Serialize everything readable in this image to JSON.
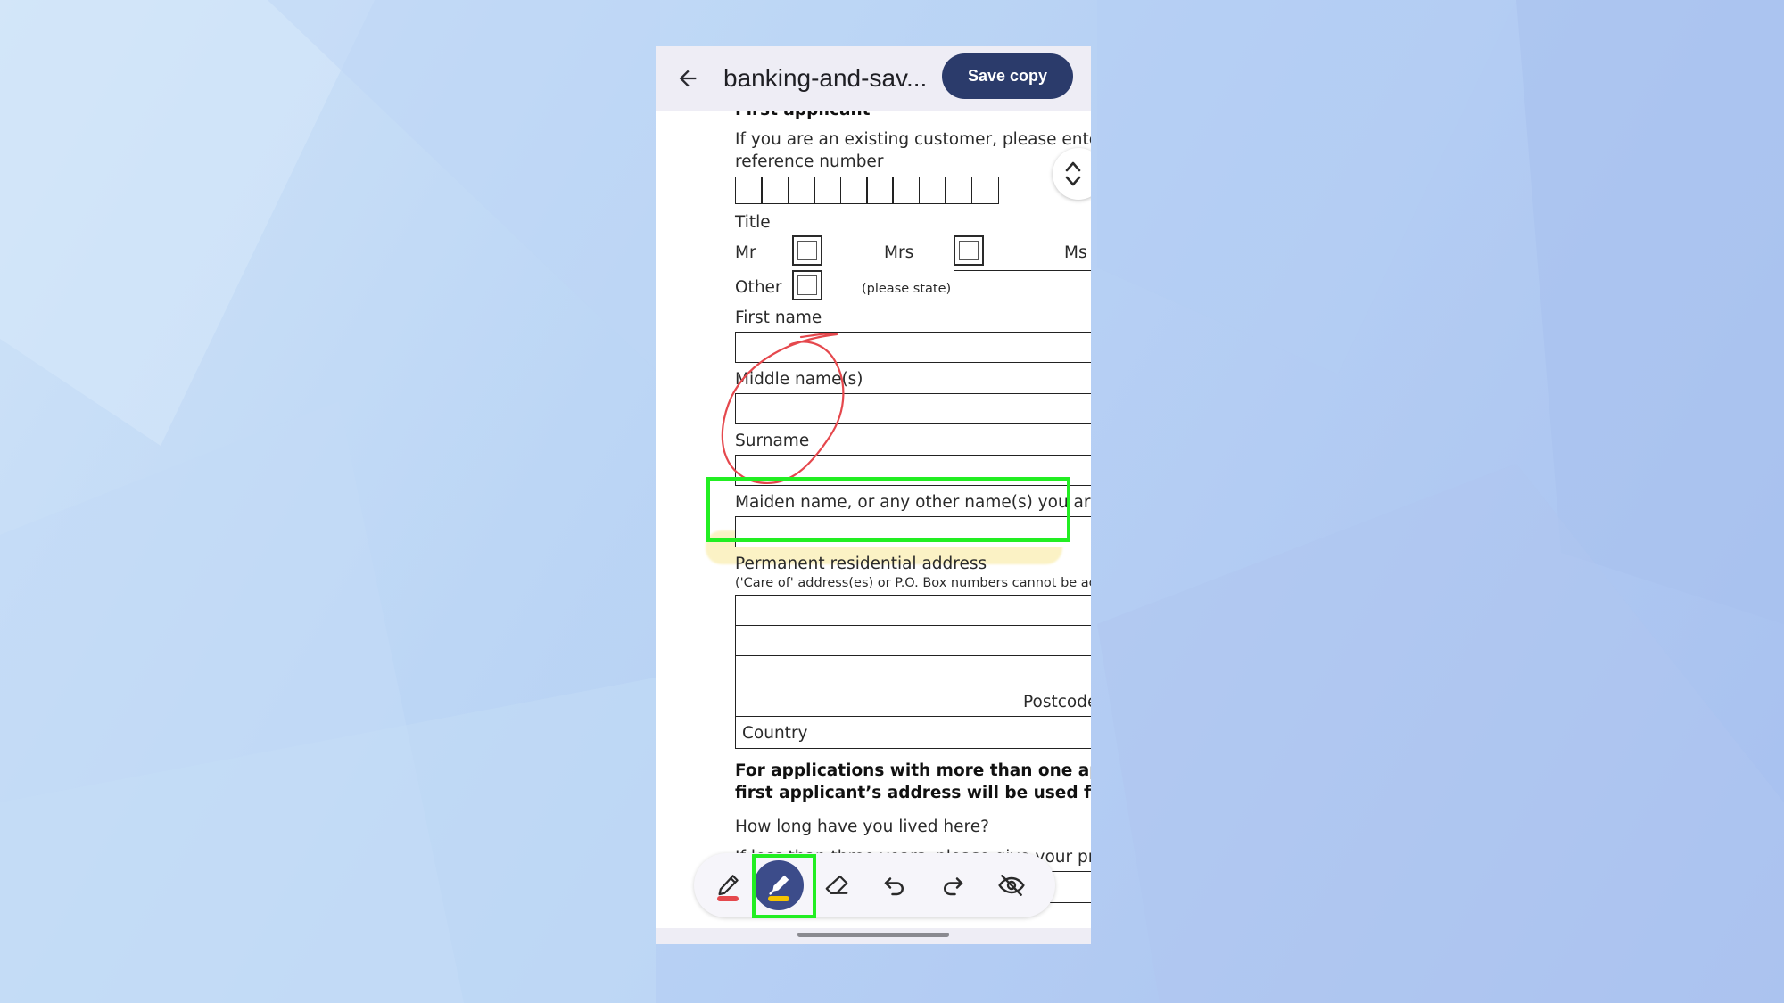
{
  "appbar": {
    "back_icon": "arrow-back-icon",
    "title": "banking-and-sav...",
    "save_label": "Save copy"
  },
  "form": {
    "section_heading": "First applicant",
    "existing_customer_text": "If you are an existing customer, please enter y",
    "reference_label": "reference number",
    "title_label": "Title",
    "mr_label": "Mr",
    "mrs_label": "Mrs",
    "ms_label": "Ms",
    "other_label": "Other",
    "please_state_label": "(please state)",
    "first_name_label": "First name",
    "middle_name_label": "Middle name(s)",
    "surname_label": "Surname",
    "maiden_name_label": "Maiden name, or any other name(s) you are, c",
    "address_label": "Permanent residential address",
    "address_note": "('Care of' address(es) or P.O. Box numbers cannot be ac",
    "postcode_label": "Postcode",
    "country_label": "Country",
    "bold_note_line1": "For applications with more than one applica",
    "bold_note_line2": "first applicant’s address will be used for all",
    "how_long_label": "How long have you lived here?",
    "partial_line": "If less than three years, please give your pr"
  },
  "toolbar": {
    "tools": [
      {
        "name": "pen-tool",
        "icon": "pen-icon",
        "swatch_color": "#e5484d",
        "active": false
      },
      {
        "name": "highlighter-tool",
        "icon": "highlighter-icon",
        "swatch_color": "#f5c400",
        "active": true
      },
      {
        "name": "eraser-tool",
        "icon": "eraser-icon",
        "active": false
      },
      {
        "name": "undo-tool",
        "icon": "undo-icon",
        "active": false
      },
      {
        "name": "redo-tool",
        "icon": "redo-icon",
        "active": false
      },
      {
        "name": "hide-annotations-tool",
        "icon": "eye-off-icon",
        "active": false
      }
    ]
  },
  "colors": {
    "accent": "#2b3b6b",
    "annotation_green": "#22ee22",
    "pen_red": "#e5484d",
    "highlight_yellow": "#f8e896"
  }
}
